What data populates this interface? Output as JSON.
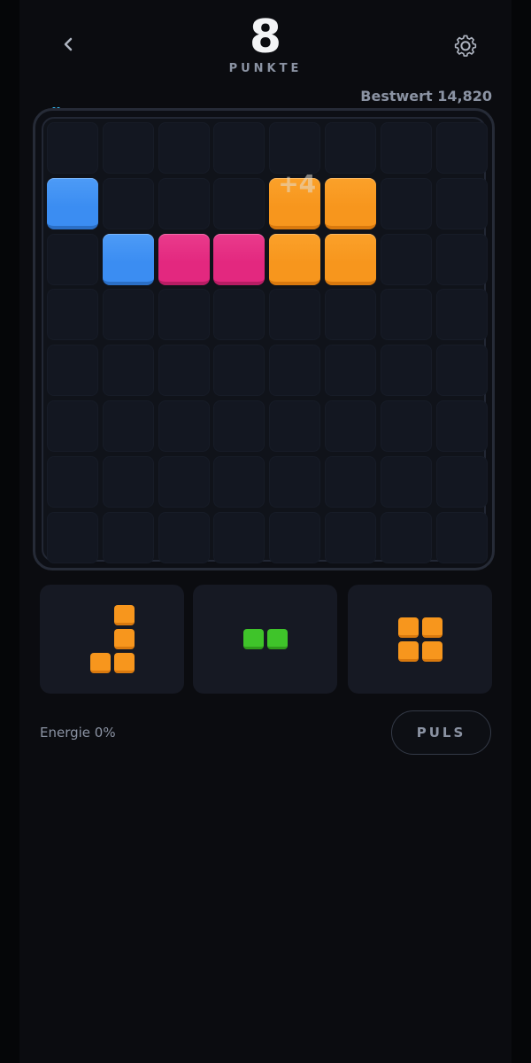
{
  "header": {
    "back_icon": "chevron-left-icon",
    "settings_icon": "gear-icon",
    "score": "8",
    "score_label": "PUNKTE",
    "best": "Bestwert 14,820"
  },
  "colors": {
    "blue": "#3b8df2",
    "pink": "#e3287f",
    "orange": "#f7961d",
    "green": "#3fc42a",
    "accent": "#38bdf8"
  },
  "board": {
    "rows": 8,
    "cols": 8,
    "filled": [
      {
        "row": 1,
        "col": 0,
        "color": "blue"
      },
      {
        "row": 1,
        "col": 4,
        "color": "orange"
      },
      {
        "row": 1,
        "col": 5,
        "color": "orange"
      },
      {
        "row": 2,
        "col": 1,
        "color": "blue"
      },
      {
        "row": 2,
        "col": 2,
        "color": "pink"
      },
      {
        "row": 2,
        "col": 3,
        "color": "pink"
      },
      {
        "row": 2,
        "col": 4,
        "color": "orange"
      },
      {
        "row": 2,
        "col": 5,
        "color": "orange"
      }
    ],
    "floating_text": "+4"
  },
  "tray": [
    {
      "name": "j-piece",
      "color": "orange",
      "cells": [
        [
          0,
          1
        ],
        [
          1,
          1
        ],
        [
          2,
          0
        ],
        [
          2,
          1
        ]
      ]
    },
    {
      "name": "domino-piece",
      "color": "green",
      "cells": [
        [
          0,
          0
        ],
        [
          0,
          1
        ]
      ]
    },
    {
      "name": "square-piece",
      "color": "orange",
      "cells": [
        [
          0,
          0
        ],
        [
          0,
          1
        ],
        [
          1,
          0
        ],
        [
          1,
          1
        ]
      ]
    }
  ],
  "footer": {
    "energy_label": "Energie 0%",
    "pulse_label": "PULS"
  }
}
